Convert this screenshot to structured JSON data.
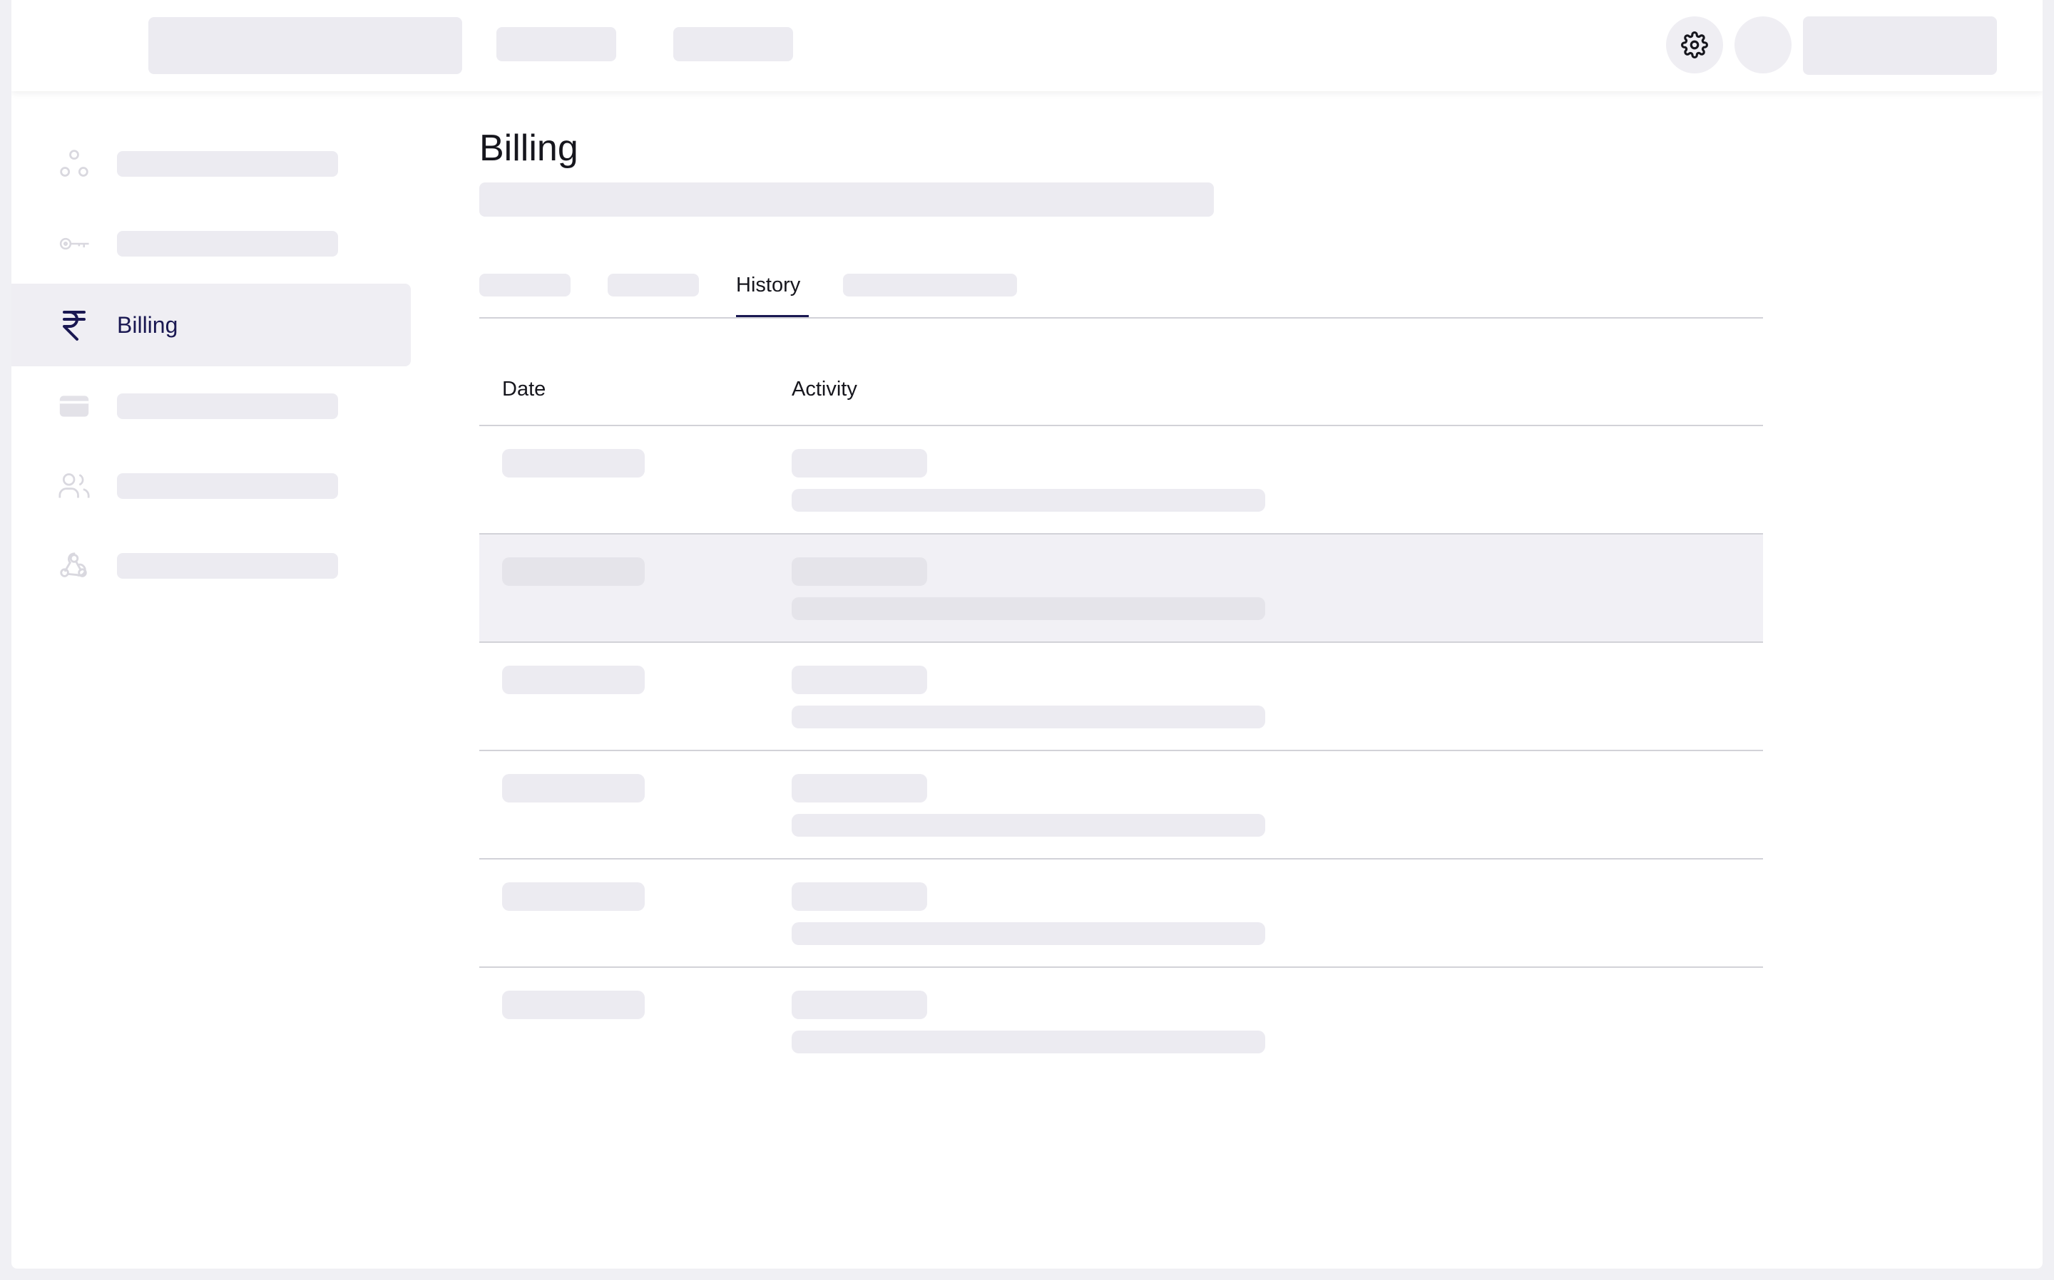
{
  "page": {
    "title": "Billing"
  },
  "sidebar": {
    "active_item": {
      "label": "Billing",
      "icon": "rupee-icon"
    },
    "icons": [
      "nodes-icon",
      "key-icon",
      "rupee-icon",
      "card-icon",
      "users-icon",
      "webhook-icon"
    ]
  },
  "tabs": {
    "active_label": "History"
  },
  "table": {
    "columns": [
      "Date",
      "Activity"
    ],
    "row_count": 6
  },
  "topbar": {
    "icons": [
      "gear-icon"
    ]
  },
  "colors": {
    "accent": "#1a1852",
    "skeleton": "#ecebf1",
    "active_bg": "#efeef3",
    "divider": "#d2d2d8"
  }
}
